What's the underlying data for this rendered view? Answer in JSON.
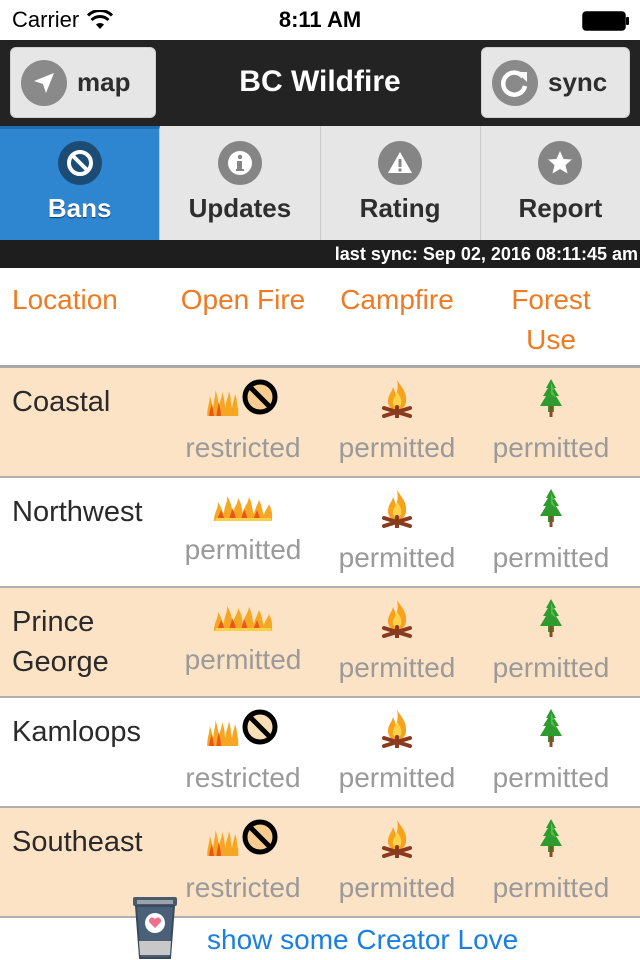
{
  "status_bar": {
    "carrier": "Carrier",
    "time": "8:11 AM",
    "icons": [
      "wifi-icon",
      "battery-icon"
    ]
  },
  "nav": {
    "title": "BC Wildfire",
    "left_button": {
      "label": "map",
      "icon": "location-arrow-icon"
    },
    "right_button": {
      "label": "sync",
      "icon": "refresh-icon"
    }
  },
  "tabs": [
    {
      "label": "Bans",
      "icon": "ban-icon",
      "active": true
    },
    {
      "label": "Updates",
      "icon": "info-icon",
      "active": false
    },
    {
      "label": "Rating",
      "icon": "warning-icon",
      "active": false
    },
    {
      "label": "Report",
      "icon": "star-icon",
      "active": false
    }
  ],
  "last_sync": "last sync: Sep 02, 2016 08:11:45 am",
  "table": {
    "headers": {
      "location": "Location",
      "open_fire": "Open Fire",
      "campfire": "Campfire",
      "forest_use_line1": "Forest",
      "forest_use_line2": "Use"
    },
    "rows": [
      {
        "location": "Coastal",
        "open_fire": "restricted",
        "campfire": "permitted",
        "forest_use": "permitted"
      },
      {
        "location": "Northwest",
        "open_fire": "permitted",
        "campfire": "permitted",
        "forest_use": "permitted"
      },
      {
        "location": "Prince George",
        "open_fire": "permitted",
        "campfire": "permitted",
        "forest_use": "permitted"
      },
      {
        "location": "Kamloops",
        "open_fire": "restricted",
        "campfire": "permitted",
        "forest_use": "permitted"
      },
      {
        "location": "Southeast",
        "open_fire": "restricted",
        "campfire": "permitted",
        "forest_use": "permitted"
      }
    ]
  },
  "footer": {
    "link_label": "show some Creator Love",
    "icon": "coffee-cup-heart-icon"
  },
  "colors": {
    "accent_orange": "#ee7a22",
    "active_tab": "#2f86d0",
    "row_shade": "#fde3c6",
    "link_blue": "#1a7fe0"
  }
}
